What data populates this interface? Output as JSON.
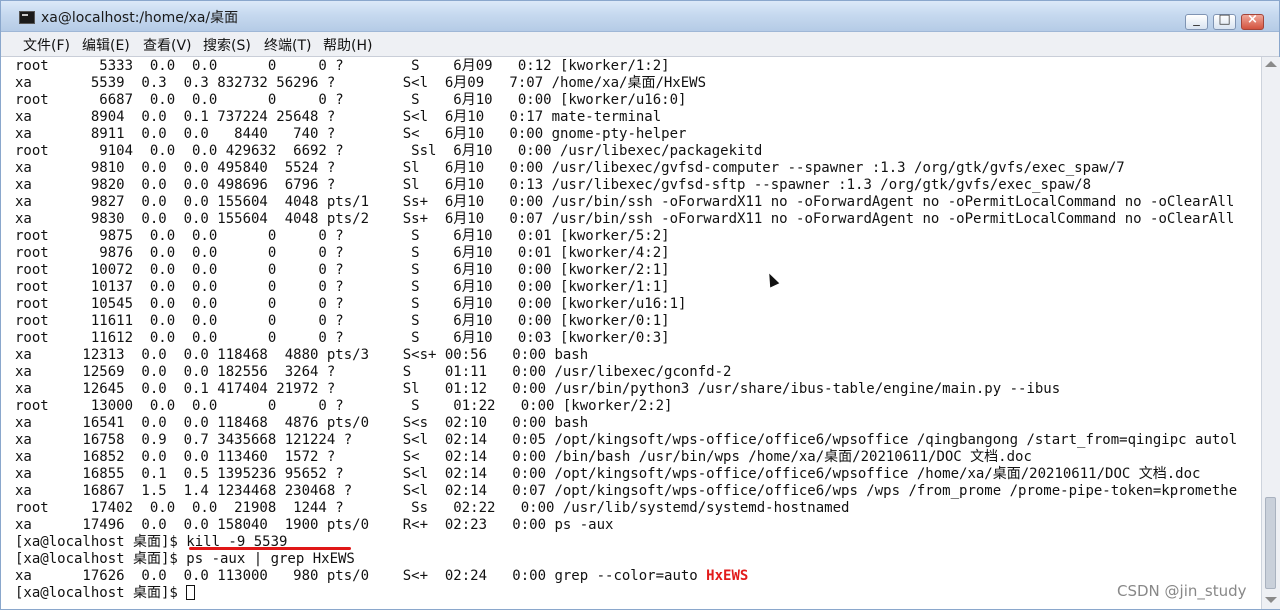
{
  "window": {
    "title": "xa@localhost:/home/xa/桌面",
    "controls": [
      "_",
      "□",
      "×"
    ]
  },
  "menu": [
    "文件(F)",
    "编辑(E)",
    "查看(V)",
    "搜索(S)",
    "终端(T)",
    "帮助(H)"
  ],
  "terminal": {
    "lines": [
      "root      5333  0.0  0.0      0     0 ?        S    6月09   0:12 [kworker/1:2]",
      "xa       5539  0.3  0.3 832732 56296 ?        S<l  6月09   7:07 /home/xa/桌面/HxEWS",
      "root      6687  0.0  0.0      0     0 ?        S    6月10   0:00 [kworker/u16:0]",
      "xa       8904  0.0  0.1 737224 25648 ?        S<l  6月10   0:17 mate-terminal",
      "xa       8911  0.0  0.0   8440   740 ?        S<   6月10   0:00 gnome-pty-helper",
      "root      9104  0.0  0.0 429632  6692 ?        Ssl  6月10   0:00 /usr/libexec/packagekitd",
      "xa       9810  0.0  0.0 495840  5524 ?        Sl   6月10   0:00 /usr/libexec/gvfsd-computer --spawner :1.3 /org/gtk/gvfs/exec_spaw/7",
      "xa       9820  0.0  0.0 498696  6796 ?        Sl   6月10   0:13 /usr/libexec/gvfsd-sftp --spawner :1.3 /org/gtk/gvfs/exec_spaw/8",
      "xa       9827  0.0  0.0 155604  4048 pts/1    Ss+  6月10   0:00 /usr/bin/ssh -oForwardX11 no -oForwardAgent no -oPermitLocalCommand no -oClearAll",
      "xa       9830  0.0  0.0 155604  4048 pts/2    Ss+  6月10   0:07 /usr/bin/ssh -oForwardX11 no -oForwardAgent no -oPermitLocalCommand no -oClearAll",
      "root      9875  0.0  0.0      0     0 ?        S    6月10   0:01 [kworker/5:2]",
      "root      9876  0.0  0.0      0     0 ?        S    6月10   0:01 [kworker/4:2]",
      "root     10072  0.0  0.0      0     0 ?        S    6月10   0:00 [kworker/2:1]",
      "root     10137  0.0  0.0      0     0 ?        S    6月10   0:00 [kworker/1:1]",
      "root     10545  0.0  0.0      0     0 ?        S    6月10   0:00 [kworker/u16:1]",
      "root     11611  0.0  0.0      0     0 ?        S    6月10   0:00 [kworker/0:1]",
      "root     11612  0.0  0.0      0     0 ?        S    6月10   0:03 [kworker/0:3]",
      "xa      12313  0.0  0.0 118468  4880 pts/3    S<s+ 00:56   0:00 bash",
      "xa      12569  0.0  0.0 182556  3264 ?        S    01:11   0:00 /usr/libexec/gconfd-2",
      "xa      12645  0.0  0.1 417404 21972 ?        Sl   01:12   0:00 /usr/bin/python3 /usr/share/ibus-table/engine/main.py --ibus",
      "root     13000  0.0  0.0      0     0 ?        S    01:22   0:00 [kworker/2:2]",
      "xa      16541  0.0  0.0 118468  4876 pts/0    S<s  02:10   0:00 bash",
      "xa      16758  0.9  0.7 3435668 121224 ?      S<l  02:14   0:05 /opt/kingsoft/wps-office/office6/wpsoffice /qingbangong /start_from=qingipc autol",
      "xa      16852  0.0  0.0 113460  1572 ?        S<   02:14   0:00 /bin/bash /usr/bin/wps /home/xa/桌面/20210611/DOC 文档.doc",
      "xa      16855  0.1  0.5 1395236 95652 ?       S<l  02:14   0:00 /opt/kingsoft/wps-office/office6/wpsoffice /home/xa/桌面/20210611/DOC 文档.doc",
      "xa      16867  1.5  1.4 1234468 230468 ?      S<l  02:14   0:07 /opt/kingsoft/wps-office/office6/wps /wps /from_prome /prome-pipe-token=kpromethe",
      "root     17402  0.0  0.0  21908  1244 ?        Ss   02:22   0:00 /usr/lib/systemd/systemd-hostnamed",
      "xa      17496  0.0  0.0 158040  1900 pts/0    R<+  02:23   0:00 ps -aux",
      "[xa@localhost 桌面]$ kill -9 5539",
      "[xa@localhost 桌面]$ ps -aux | grep HxEWS"
    ],
    "grep_line_prefix": "xa      17626  0.0  0.0 113000   980 pts/0    S<+  02:24   0:00 grep --color=auto ",
    "grep_match": "HxEWS",
    "prompt": "[xa@localhost 桌面]$ "
  },
  "watermark": "CSDN @jin_study",
  "colors": {
    "annotation_underline": "#e01717",
    "grep_highlight": "#e21b1b"
  }
}
